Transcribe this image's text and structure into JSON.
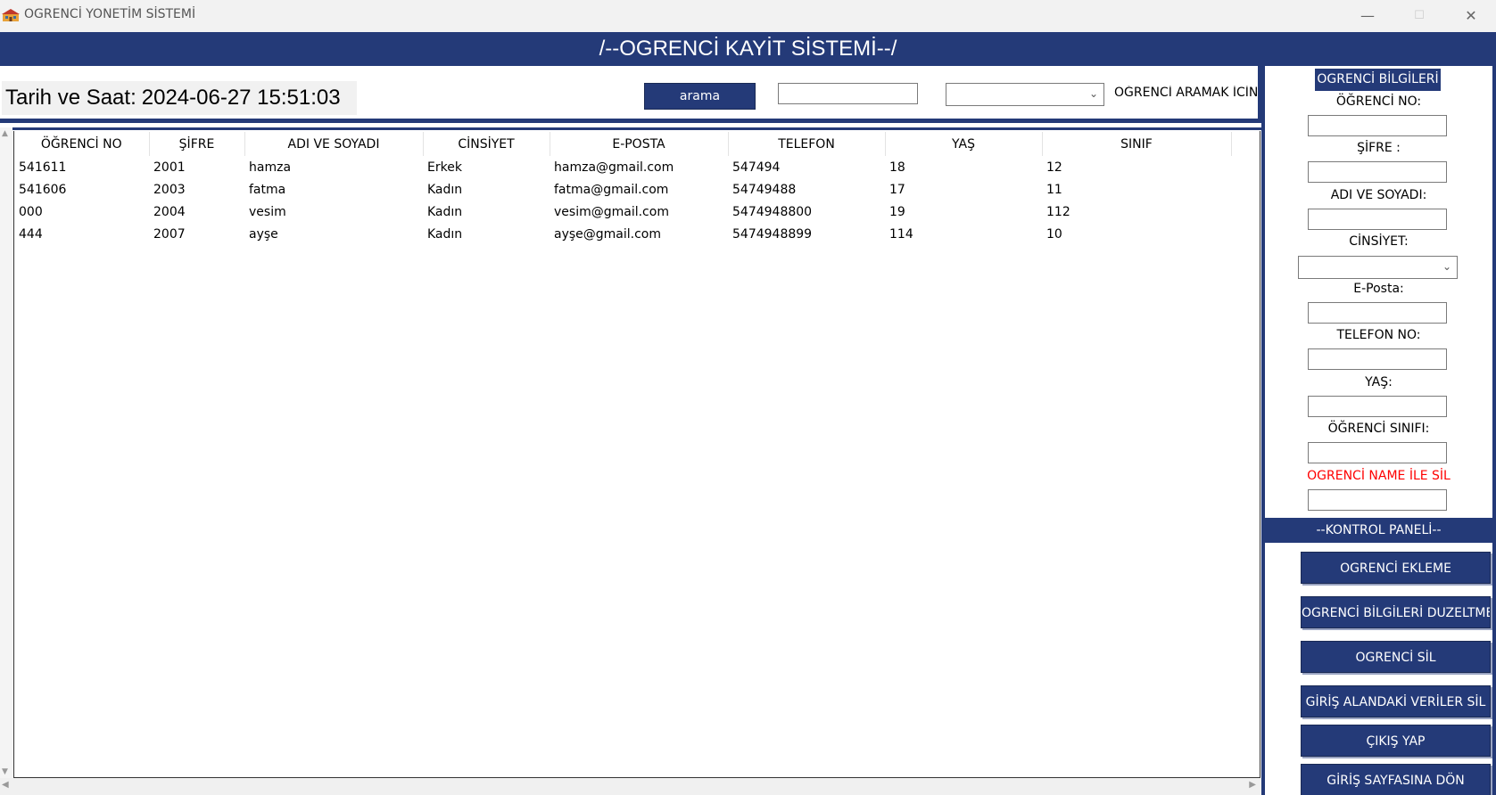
{
  "window": {
    "title": "OGRENCİ YONETİM SİSTEMİ",
    "minimize_glyph": "—",
    "maximize_glyph": "☐",
    "close_glyph": "✕"
  },
  "header": {
    "title": "/--OGRENCİ KAYİT SİSTEMİ--/"
  },
  "toolbar": {
    "datetime_label": "Tarih ve Saat:",
    "datetime_value": "2024-06-27 15:51:03",
    "search_button": "arama",
    "search_value": "",
    "search_field_selected": "",
    "search_hint": "ÖĞRENCİ ARAMAK İCİN"
  },
  "table": {
    "columns": [
      "ÖĞRENCİ NO",
      "ŞİFRE",
      "ADI VE SOYADI",
      "CİNSİYET",
      "E-POSTA",
      "TELEFON",
      "YAŞ",
      "SINIF"
    ],
    "rows": [
      [
        "541611",
        "2001",
        "hamza",
        "Erkek",
        "hamza@gmail.com",
        "547494",
        "18",
        "12"
      ],
      [
        "541606",
        "2003",
        "fatma",
        "Kadın",
        "fatma@gmail.com",
        "54749488",
        "17",
        "11"
      ],
      [
        "000",
        "2004",
        "vesim",
        "Kadın",
        "vesim@gmail.com",
        "5474948800",
        "19",
        "112"
      ],
      [
        "444",
        "2007",
        "ayşe",
        "Kadın",
        "ayşe@gmail.com",
        "5474948899",
        "114",
        "10"
      ]
    ]
  },
  "panel": {
    "title": "OGRENCİ BİLGİLERİ :",
    "fields": {
      "ogrenci_no": "ÖĞRENCİ NO:",
      "sifre": "ŞİFRE :",
      "adi_soyadi": "ADI VE SOYADI:",
      "cinsiyet": "CİNSİYET:",
      "eposta": "E-Posta:",
      "telefon": "TELEFON NO:",
      "yas": "YAŞ:",
      "sinif": "ÖĞRENCİ SINIFI:",
      "sil_name": "OGRENCİ NAME İLE SİL"
    }
  },
  "control": {
    "title": "--KONTROL PANELİ--",
    "buttons": {
      "ekle": "OGRENCİ EKLEME",
      "duzelt": "OGRENCİ BİLGİLERİ DUZELTME",
      "sil": "OGRENCİ SİL",
      "temizle": "GİRİŞ ALANDAKİ VERİLER SİL",
      "cikis": "ÇIKIŞ YAP",
      "giris": "GİRİŞ SAYFASINA DÖN"
    }
  },
  "colors": {
    "accent": "#243a78",
    "danger": "#ff0000"
  }
}
